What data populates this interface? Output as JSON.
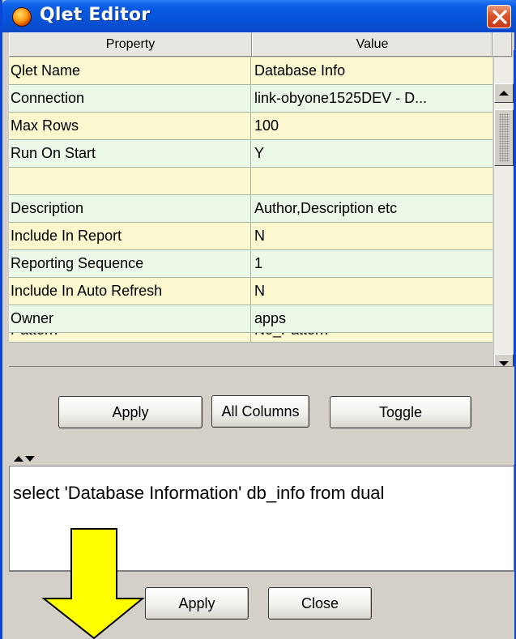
{
  "window": {
    "title": "Qlet Editor"
  },
  "table": {
    "headers": [
      "Property",
      "Value"
    ],
    "rows": [
      {
        "property": "Qlet Name",
        "value": "Database Info"
      },
      {
        "property": "Connection",
        "value": "link-obyone1525DEV - D..."
      },
      {
        "property": "Max Rows",
        "value": "100"
      },
      {
        "property": "Run On Start",
        "value": "Y"
      },
      {
        "property": "",
        "value": ""
      },
      {
        "property": "Description",
        "value": "Author,Description etc"
      },
      {
        "property": "Include In Report",
        "value": "N"
      },
      {
        "property": "Reporting Sequence",
        "value": "1"
      },
      {
        "property": "Include In Auto Refresh",
        "value": "N"
      },
      {
        "property": "Owner",
        "value": "apps"
      },
      {
        "property": "Pattern",
        "value": "No_Pattern"
      }
    ]
  },
  "buttons": {
    "apply_top": "Apply",
    "all_columns": "All Columns",
    "toggle": "Toggle",
    "apply_bottom": "Apply",
    "close": "Close"
  },
  "sql_editor": {
    "text": "select 'Database Information'  db_info from dual"
  },
  "colors": {
    "titlebar": "#0753d8",
    "row_odd": "#fbf7cf",
    "row_even": "#ecf8e8",
    "annotation_arrow": "#ffff00"
  },
  "icons": {
    "app": "qlet-app-icon",
    "close": "close-x-icon",
    "annotation": "down-arrow-icon"
  }
}
